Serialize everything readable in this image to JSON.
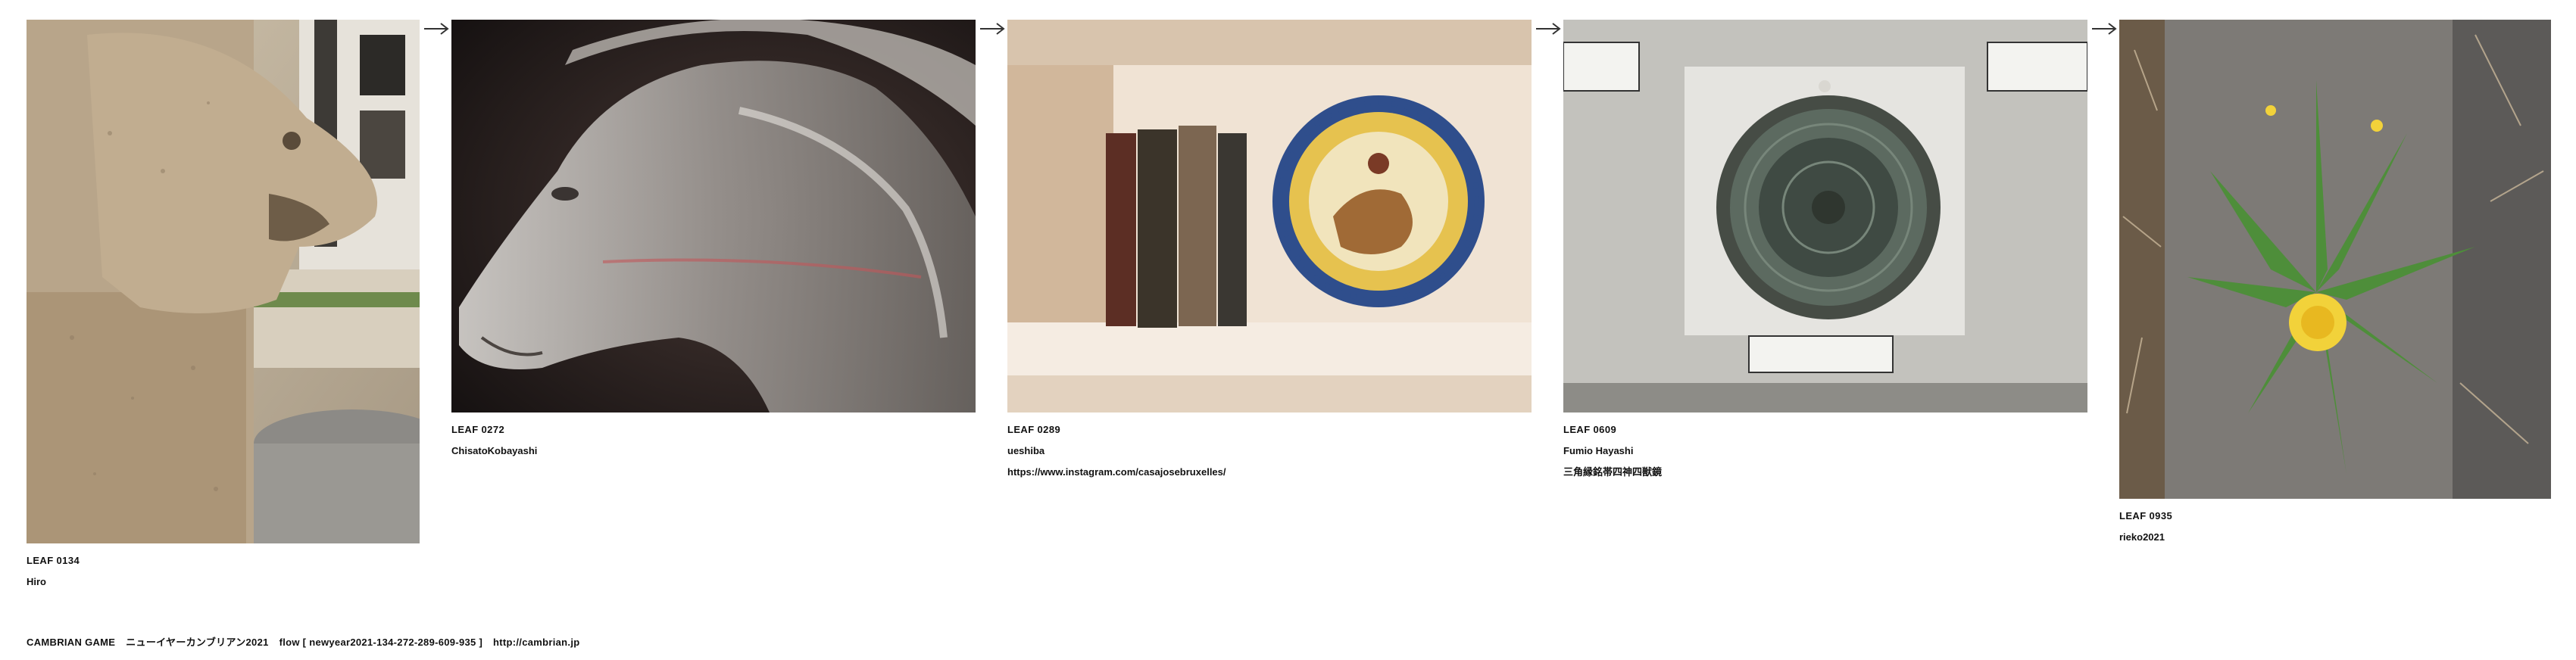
{
  "leaves": [
    {
      "id": "LEAF 0134",
      "credit": "Hiro",
      "extra": "",
      "image": "stone-lion-fountain-photo"
    },
    {
      "id": "LEAF 0272",
      "credit": "ChisatoKobayashi",
      "extra": "",
      "image": "glass-horse-head-photo"
    },
    {
      "id": "LEAF 0289",
      "credit": "ueshiba",
      "extra": "https://www.instagram.com/casajosebruxelles/",
      "image": "books-and-plate-shelf-photo"
    },
    {
      "id": "LEAF 0609",
      "credit": "Fumio Hayashi",
      "extra": "三角縁銘帯四神四獣鏡",
      "image": "bronze-mirror-museum-photo"
    },
    {
      "id": "LEAF 0935",
      "credit": "rieko2021",
      "extra": "",
      "image": "dandelion-on-pavement-photo"
    }
  ],
  "arrow_icon": "right-arrow-icon",
  "footer": {
    "title": "CAMBRIAN GAME",
    "subtitle": "ニューイヤーカンブリアン2021",
    "flow": "flow [ newyear2021-134-272-289-609-935 ]",
    "url": "http://cambrian.jp"
  }
}
